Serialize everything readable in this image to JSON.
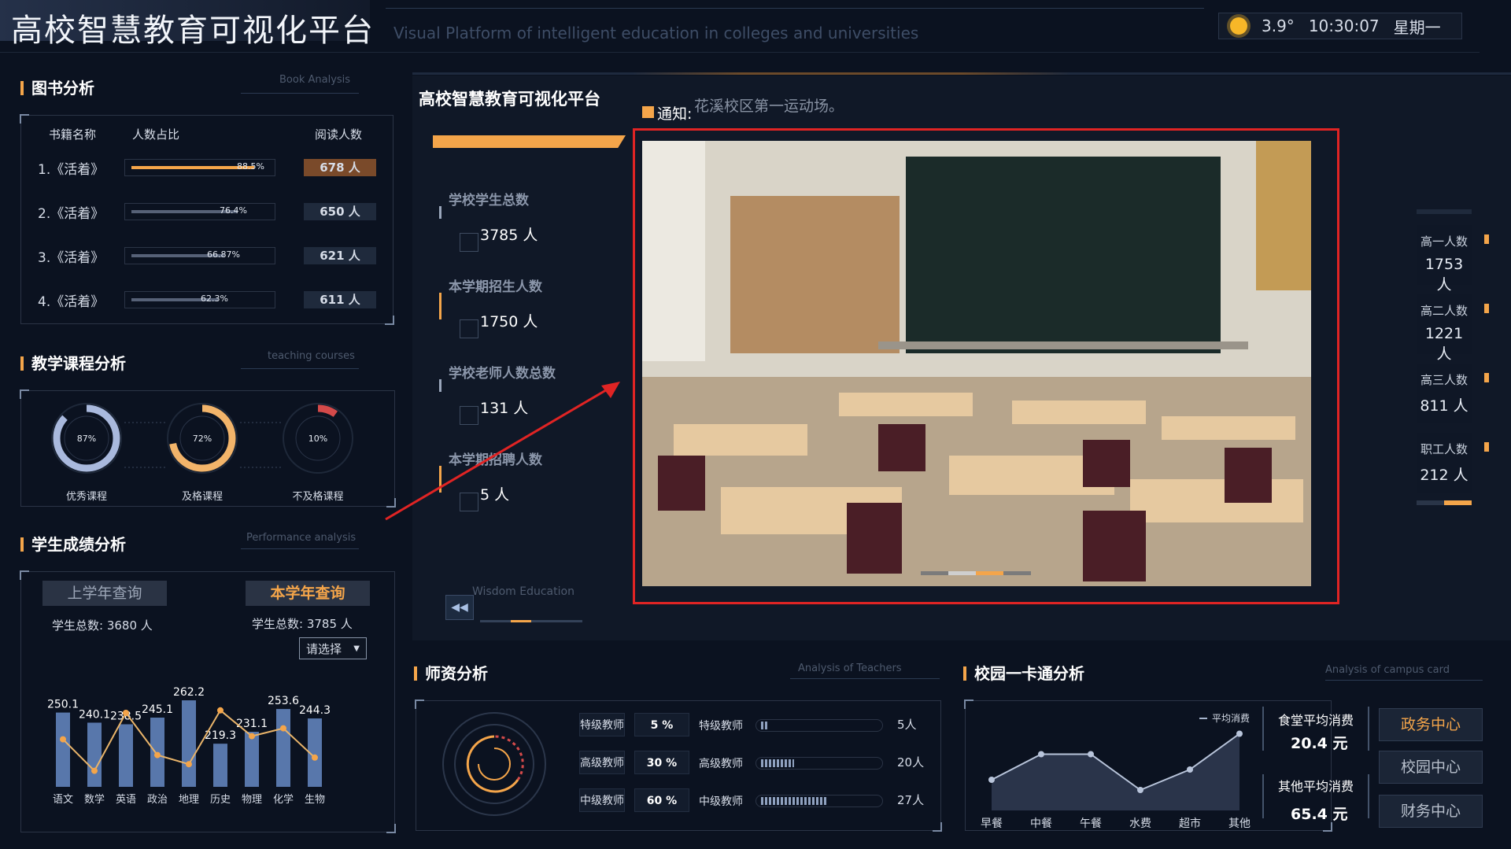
{
  "header": {
    "title": "高校智慧教育可视化平台",
    "subtitle": "Visual Platform of intelligent education in colleges and universities",
    "temperature": "3.9°",
    "time": "10:30:07",
    "weekday": "星期一"
  },
  "books": {
    "title": "图书分析",
    "subtitle": "Book Analysis",
    "columns": [
      "书籍名称",
      "人数占比",
      "阅读人数"
    ],
    "rows": [
      {
        "name": "1.《活着》",
        "pct": "88.5%",
        "pct_value": 88.5,
        "count": "678 人",
        "highlight": true
      },
      {
        "name": "2.《活着》",
        "pct": "76.4%",
        "pct_value": 76.4,
        "count": "650 人",
        "highlight": false
      },
      {
        "name": "3.《活着》",
        "pct": "66.87%",
        "pct_value": 66.87,
        "count": "621 人",
        "highlight": false
      },
      {
        "name": "4.《活着》",
        "pct": "62.3%",
        "pct_value": 62.3,
        "count": "611 人",
        "highlight": false
      }
    ]
  },
  "courses": {
    "title": "教学课程分析",
    "subtitle": "teaching courses",
    "items": [
      {
        "label": "优秀课程",
        "pct": "87%",
        "value": 87,
        "color": "#a9b9dd"
      },
      {
        "label": "及格课程",
        "pct": "72%",
        "value": 72,
        "color": "#f2b46a"
      },
      {
        "label": "不及格课程",
        "pct": "10%",
        "value": 10,
        "color": "#d44a4a"
      }
    ]
  },
  "scores": {
    "title": "学生成绩分析",
    "subtitle": "Performance analysis",
    "prev_btn": "上学年查询",
    "cur_btn": "本学年查询",
    "prev_total": "学生总数: 3680 人",
    "cur_total": "学生总数: 3785 人",
    "select": "请选择"
  },
  "chart_data": {
    "type": "bar",
    "categories": [
      "语文",
      "数学",
      "英语",
      "政治",
      "地理",
      "历史",
      "物理",
      "化学",
      "生物"
    ],
    "values": [
      250.1,
      240.1,
      238.5,
      245.1,
      262.2,
      219.3,
      231.1,
      253.6,
      244.3
    ],
    "ylim": [
      0,
      270
    ]
  },
  "center": {
    "panel_title": "高校智慧教育可视化平台",
    "notice_label": "通知:",
    "notice_text": "花溪校区第一运动场。",
    "stats": [
      {
        "label": "学校学生总数",
        "value": "3785 人"
      },
      {
        "label": "本学期招生人数",
        "value": "1750 人"
      },
      {
        "label": "学校老师人数总数",
        "value": "131 人"
      },
      {
        "label": "本学期招聘人数",
        "value": "5 人"
      }
    ],
    "wisdom": "Wisdom Education",
    "grades": [
      {
        "label": "高一人数",
        "value": "1753 人"
      },
      {
        "label": "高二人数",
        "value": "1221 人"
      },
      {
        "label": "高三人数",
        "value": "811 人"
      },
      {
        "label": "职工人数",
        "value": "212 人"
      }
    ]
  },
  "teachers": {
    "title": "师资分析",
    "subtitle": "Analysis of Teachers",
    "rows": [
      {
        "label": "特级教师",
        "pct": "5 %",
        "name": "特级教师",
        "count": "5人",
        "fill": 0.05
      },
      {
        "label": "高级教师",
        "pct": "30 %",
        "name": "高级教师",
        "count": "20人",
        "fill": 0.3
      },
      {
        "label": "中级教师",
        "pct": "60 %",
        "name": "中级教师",
        "count": "27人",
        "fill": 0.6
      }
    ]
  },
  "card": {
    "title": "校园一卡通分析",
    "subtitle": "Analysis of campus card",
    "legend": "平均消费",
    "x": [
      "早餐",
      "中餐",
      "午餐",
      "水费",
      "超市",
      "其他"
    ],
    "values": [
      30,
      55,
      55,
      20,
      40,
      75
    ],
    "canteen_label": "食堂平均消费",
    "canteen_value": "20.4 元",
    "other_label": "其他平均消费",
    "other_value": "65.4 元",
    "buttons": [
      "政务中心",
      "校园中心",
      "财务中心"
    ]
  }
}
